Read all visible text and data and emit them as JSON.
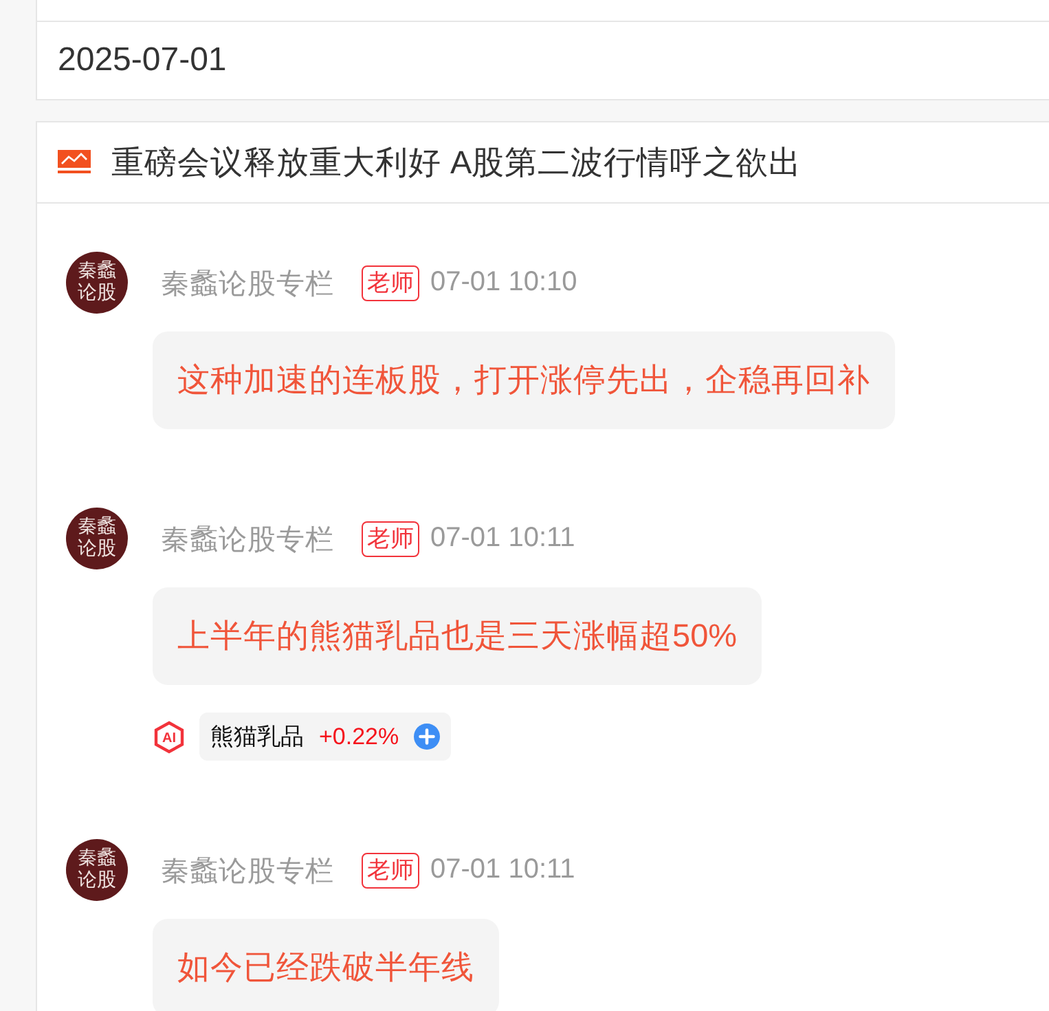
{
  "date_header": {
    "text": "2025-07-01"
  },
  "article": {
    "title": "重磅会议释放重大利好 A股第二波行情呼之欲出",
    "messages": [
      {
        "avatar_text": "秦蠡论股",
        "author": "秦蠡论股专栏",
        "badge": "老师",
        "time": "07-01 10:10",
        "text": "这种加速的连板股，打开涨停先出，企稳再回补"
      },
      {
        "avatar_text": "秦蠡论股",
        "author": "秦蠡论股专栏",
        "badge": "老师",
        "time": "07-01 10:11",
        "text": "上半年的熊猫乳品也是三天涨幅超50%",
        "stocks": [
          {
            "ai_mark": "AI",
            "name": "熊猫乳品",
            "change": "+0.22%"
          }
        ]
      },
      {
        "avatar_text": "秦蠡论股",
        "author": "秦蠡论股专栏",
        "badge": "老师",
        "time": "07-01 10:11",
        "text": "如今已经跌破半年线"
      }
    ]
  }
}
